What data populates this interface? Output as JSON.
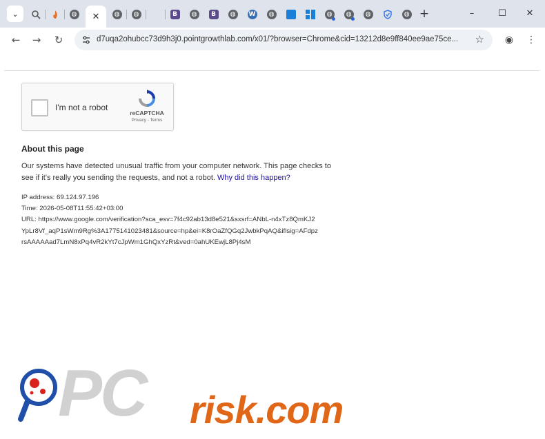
{
  "browser": {
    "tabs": [
      {
        "name": "tab-search-history",
        "icon": "magnifier-icon"
      },
      {
        "name": "tab-1",
        "icon": "flame-icon",
        "color": "#e8702a"
      },
      {
        "name": "tab-2",
        "icon": "globe-icon"
      },
      {
        "name": "tab-active",
        "icon": "close-icon",
        "close": "✕"
      },
      {
        "name": "tab-4",
        "icon": "globe-icon"
      },
      {
        "name": "tab-5",
        "icon": "globe-icon"
      },
      {
        "name": "tab-6",
        "icon": "blank-icon"
      },
      {
        "name": "tab-7",
        "icon": "bootstrap-icon",
        "letter": "B",
        "color": "#5b4b8a"
      },
      {
        "name": "tab-8",
        "icon": "globe-icon"
      },
      {
        "name": "tab-9",
        "icon": "bootstrap-icon",
        "letter": "B",
        "color": "#5b4b8a"
      },
      {
        "name": "tab-10",
        "icon": "globe-icon"
      },
      {
        "name": "tab-11",
        "icon": "wordpress-icon",
        "letter": "W",
        "color": "#3b6fb5"
      },
      {
        "name": "tab-12",
        "icon": "globe-icon"
      },
      {
        "name": "tab-13",
        "icon": "blue-square-icon",
        "color": "#1a7fd6"
      },
      {
        "name": "tab-14",
        "icon": "tiles-icon",
        "color": "#1a7fd6"
      },
      {
        "name": "tab-15",
        "icon": "globe-icon"
      },
      {
        "name": "tab-16",
        "icon": "globe-icon"
      },
      {
        "name": "tab-17",
        "icon": "globe-icon"
      },
      {
        "name": "tab-18",
        "icon": "shield-icon",
        "color": "#3a78e6"
      },
      {
        "name": "tab-19",
        "icon": "globe-icon"
      }
    ],
    "new_tab": "+",
    "window": {
      "minimize": "–",
      "maximize": "☐",
      "close": "✕"
    }
  },
  "toolbar": {
    "back": "←",
    "forward": "→",
    "reload": "↻",
    "url": "d7uqa2ohubcc73d9h3j0.pointgrowthlab.com/x01/?browser=Chrome&cid=13212d8e9ff840ee9ae75ce...",
    "bookmark": "☆",
    "profile": "◉",
    "menu": "⋮"
  },
  "captcha": {
    "label": "I'm not a robot",
    "brand": "reCAPTCHA",
    "links": "Privacy - Terms"
  },
  "about": {
    "title": "About this page",
    "body_text": "Our systems have detected unusual traffic from your computer network. This page checks to see if it's really you sending the requests, and not a robot.",
    "link_text": "Why did this happen?"
  },
  "details": {
    "ip": "IP address: 69.124.97.196",
    "time": "Time: 2026-05-08T11:55:42+03:00",
    "url_line1": "URL: https://www.google.com/verification?sca_esv=7f4c92ab13d8e521&sxsrf=ANbL-n4xTz8QmKJ2",
    "url_line2": "YpLr8Vf_aqP1sWm9Rg%3A1775141023481&source=hp&ei=K8rOaZfQGq2JwbkPqAQ&iflsig=AFdpz",
    "url_line3": "rsAAAAAad7LmN8xPq4vR2kYt7cJpWm1GhQxYzRt&ved=0ahUKEwjL8Pj4sM"
  },
  "watermark": {
    "pc": "PC",
    "risk": "risk.com",
    "accent": "#e06618"
  }
}
